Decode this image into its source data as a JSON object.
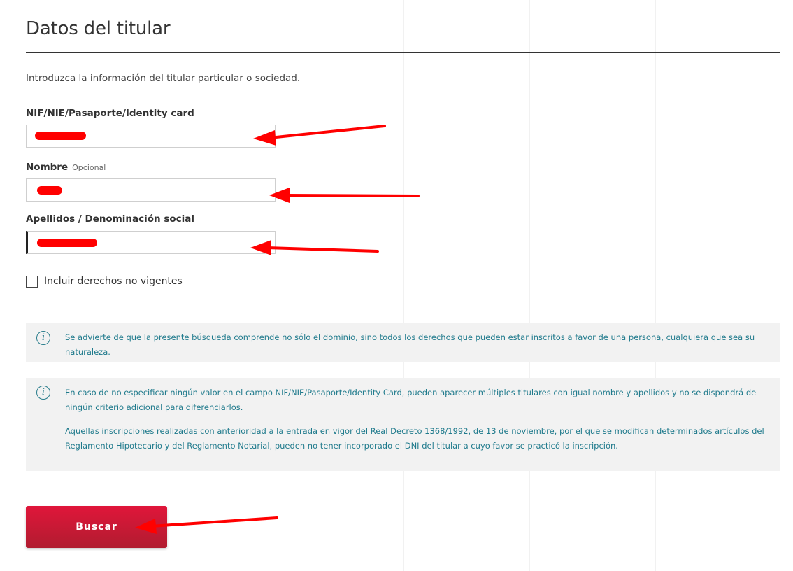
{
  "page": {
    "title": "Datos del titular"
  },
  "intro": "Introduzca la información del titular particular o sociedad.",
  "fields": {
    "nif": {
      "label": "NIF/NIE/Pasaporte/Identity card"
    },
    "nombre": {
      "label": "Nombre",
      "optional": "Opcional"
    },
    "apellidos": {
      "label": "Apellidos / Denominación social"
    }
  },
  "checkbox": {
    "label": "Incluir derechos no vigentes",
    "checked": false
  },
  "notices": [
    {
      "icon": "info-icon",
      "paragraphs": [
        "Se advierte de que la presente búsqueda comprende no sólo el dominio, sino todos los derechos que pueden estar inscritos a favor de una persona, cualquiera que sea su naturaleza."
      ]
    },
    {
      "icon": "info-icon",
      "paragraphs": [
        "En caso de no especificar ningún valor en el campo NIF/NIE/Pasaporte/Identity Card, pueden aparecer múltiples titulares con igual nombre y apellidos y no se dispondrá de ningún criterio adicional para diferenciarlos.",
        "Aquellas inscripciones realizadas con anterioridad a la entrada en vigor del Real Decreto 1368/1992, de 13 de noviembre, por el que se modifican determinados artículos del Reglamento Hipotecario y del Reglamento Notarial, pueden no tener incorporado el DNI del titular a cuyo favor se practicó la inscripción."
      ]
    }
  ],
  "button": {
    "label": "Buscar"
  },
  "colors": {
    "accent": "#d5183a",
    "notice_text": "#1f7a8c",
    "annotation": "#ff0000"
  }
}
